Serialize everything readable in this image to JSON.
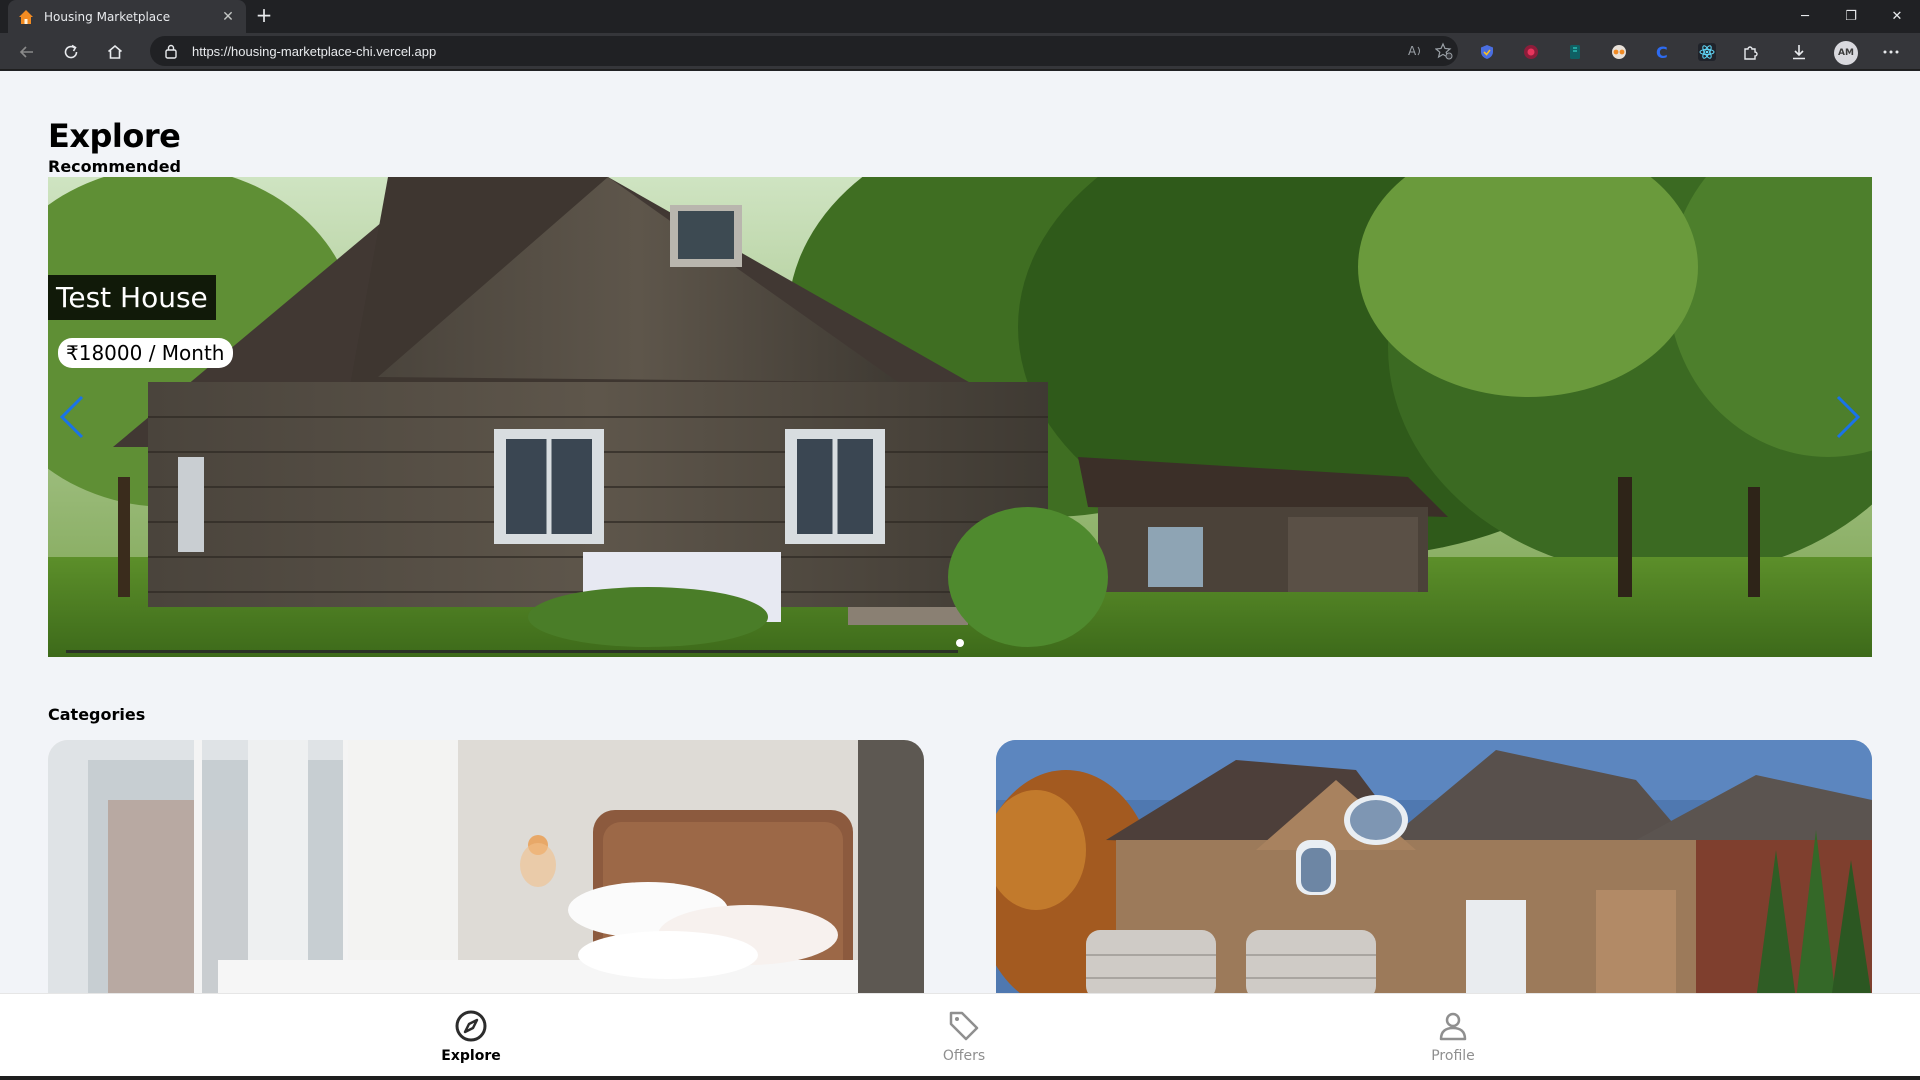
{
  "browser": {
    "tab_title": "Housing Marketplace",
    "url": "https://housing-marketplace-chi.vercel.app",
    "profile_initials": "AM",
    "window_controls": {
      "minimize": "─",
      "restore": "❐",
      "close": "✕"
    },
    "new_tab": "+",
    "tab_close": "✕"
  },
  "page": {
    "title": "Explore",
    "recommended_label": "Recommended",
    "categories_label": "Categories"
  },
  "slider": {
    "listing_name": "Test House",
    "listing_price": "₹18000 / Month",
    "accent_color": "#1a73e8"
  },
  "bottom_nav": {
    "items": [
      {
        "label": "Explore",
        "icon": "compass-icon",
        "active": true
      },
      {
        "label": "Offers",
        "icon": "tag-icon",
        "active": false
      },
      {
        "label": "Profile",
        "icon": "person-icon",
        "active": false
      }
    ]
  }
}
